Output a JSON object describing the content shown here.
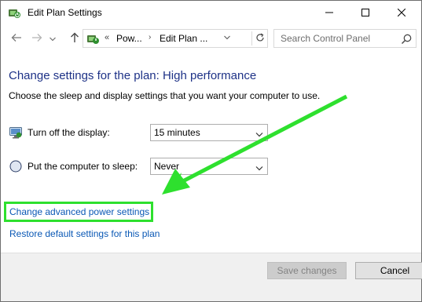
{
  "window": {
    "title": "Edit Plan Settings",
    "app_icon": "power-options-icon",
    "controls": [
      "minimize-icon",
      "maximize-icon",
      "close-icon"
    ]
  },
  "navigation": {
    "back_icon": "arrow-left-icon",
    "forward_icon": "arrow-right-icon",
    "recent_icon": "chevron-down-icon",
    "up_icon": "arrow-up-icon",
    "address": {
      "overflow": "«",
      "crumbs": [
        "Pow...",
        "Edit Plan ..."
      ],
      "refresh_icon": "refresh-icon"
    },
    "search": {
      "placeholder": "Search Control Panel",
      "icon": "search-icon"
    }
  },
  "main": {
    "heading": "Change settings for the plan: High performance",
    "subtext": "Choose the sleep and display settings that you want your computer to use.",
    "settings": [
      {
        "label": "Turn off the display:",
        "value": "15 minutes",
        "icon": "monitor-icon"
      },
      {
        "label": "Put the computer to sleep:",
        "value": "Never",
        "icon": "moon-icon"
      }
    ],
    "links": {
      "advanced": "Change advanced power settings",
      "restore": "Restore default settings for this plan"
    }
  },
  "footer": {
    "save_label": "Save changes",
    "cancel_label": "Cancel"
  },
  "annotation": {
    "color": "#2ee02e"
  }
}
